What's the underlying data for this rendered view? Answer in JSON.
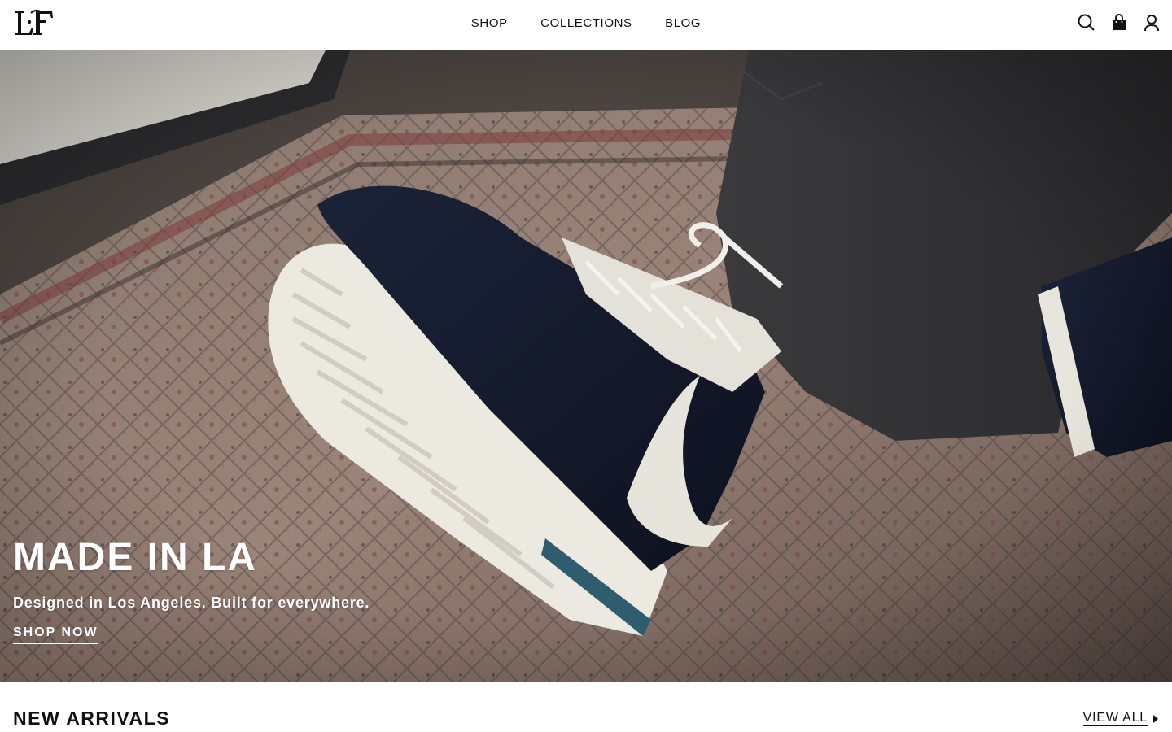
{
  "brand": {
    "logo_alt": "LF"
  },
  "nav": {
    "items": [
      {
        "label": "SHOP"
      },
      {
        "label": "COLLECTIONS"
      },
      {
        "label": "BLOG"
      }
    ]
  },
  "header_icons": [
    "search-icon",
    "bag-icon",
    "account-icon"
  ],
  "hero": {
    "title": "MADE IN LA",
    "subtitle": "Designed in Los Angeles. Built for everywhere.",
    "cta": "SHOP NOW",
    "image_subject": "navy leather sneaker with white swoosh on patterned rug"
  },
  "new_arrivals": {
    "title": "NEW ARRIVALS",
    "view_all": "VIEW ALL"
  },
  "colors": {
    "text": "#111111",
    "background": "#ffffff",
    "hero_text": "#ffffff"
  }
}
